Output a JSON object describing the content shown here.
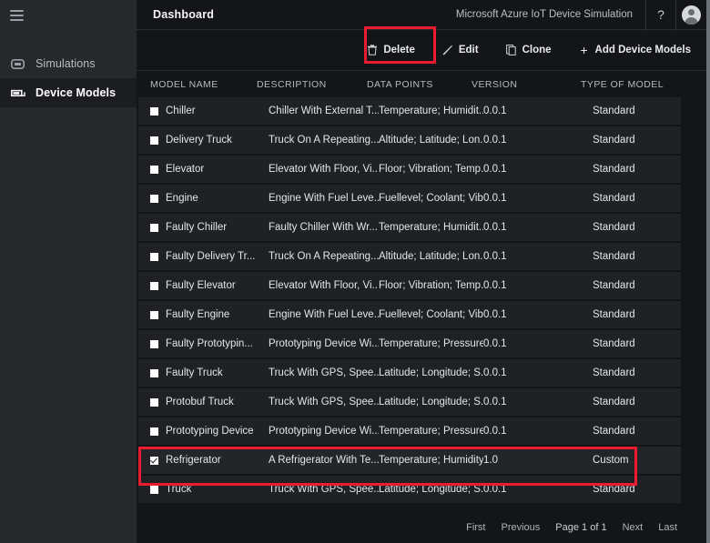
{
  "sidebar": {
    "menu_icon": "hamburger-icon",
    "items": [
      {
        "label": "Simulations",
        "icon": "simulations-icon",
        "active": false
      },
      {
        "label": "Device Models",
        "icon": "device-models-icon",
        "active": true
      }
    ]
  },
  "topbar": {
    "title": "Dashboard",
    "app_name": "Microsoft Azure IoT Device Simulation",
    "help_label": "?",
    "avatar": "user-avatar-icon"
  },
  "toolbar": {
    "delete_label": "Delete",
    "edit_label": "Edit",
    "clone_label": "Clone",
    "add_label": "Add Device Models",
    "delete_icon": "trash-icon",
    "edit_icon": "pencil-icon",
    "clone_icon": "copy-icon",
    "add_icon": "plus-icon"
  },
  "table": {
    "headers": {
      "name": "MODEL NAME",
      "description": "DESCRIPTION",
      "datapoints": "DATA POINTS",
      "version": "VERSION",
      "type": "TYPE OF MODEL"
    },
    "rows": [
      {
        "name": "Chiller",
        "description": "Chiller With External T...",
        "datapoints": "Temperature; Humidit...",
        "version": "0.0.1",
        "type": "Standard",
        "selected": false
      },
      {
        "name": "Delivery Truck",
        "description": "Truck On A Repeating...",
        "datapoints": "Altitude; Latitude; Lon...",
        "version": "0.0.1",
        "type": "Standard",
        "selected": false
      },
      {
        "name": "Elevator",
        "description": "Elevator With Floor, Vi...",
        "datapoints": "Floor; Vibration; Temp...",
        "version": "0.0.1",
        "type": "Standard",
        "selected": false
      },
      {
        "name": "Engine",
        "description": "Engine With Fuel Leve...",
        "datapoints": "Fuellevel; Coolant; Vib...",
        "version": "0.0.1",
        "type": "Standard",
        "selected": false
      },
      {
        "name": "Faulty Chiller",
        "description": "Faulty Chiller With Wr...",
        "datapoints": "Temperature; Humidit...",
        "version": "0.0.1",
        "type": "Standard",
        "selected": false
      },
      {
        "name": "Faulty Delivery Tr...",
        "description": "Truck On A Repeating...",
        "datapoints": "Altitude; Latitude; Lon...",
        "version": "0.0.1",
        "type": "Standard",
        "selected": false
      },
      {
        "name": "Faulty Elevator",
        "description": "Elevator With Floor, Vi...",
        "datapoints": "Floor; Vibration; Temp...",
        "version": "0.0.1",
        "type": "Standard",
        "selected": false
      },
      {
        "name": "Faulty Engine",
        "description": "Engine With Fuel Leve...",
        "datapoints": "Fuellevel; Coolant; Vib...",
        "version": "0.0.1",
        "type": "Standard",
        "selected": false
      },
      {
        "name": "Faulty Prototypin...",
        "description": "Prototyping Device Wi...",
        "datapoints": "Temperature; Pressure...",
        "version": "0.0.1",
        "type": "Standard",
        "selected": false
      },
      {
        "name": "Faulty Truck",
        "description": "Truck With GPS, Spee...",
        "datapoints": "Latitude; Longitude; S...",
        "version": "0.0.1",
        "type": "Standard",
        "selected": false
      },
      {
        "name": "Protobuf Truck",
        "description": "Truck With GPS, Spee...",
        "datapoints": "Latitude; Longitude; S...",
        "version": "0.0.1",
        "type": "Standard",
        "selected": false
      },
      {
        "name": "Prototyping Device",
        "description": "Prototyping Device Wi...",
        "datapoints": "Temperature; Pressure...",
        "version": "0.0.1",
        "type": "Standard",
        "selected": false
      },
      {
        "name": "Refrigerator",
        "description": "A Refrigerator With Te...",
        "datapoints": "Temperature; Humidity",
        "version": "1.0",
        "type": "Custom",
        "selected": true
      },
      {
        "name": "Truck",
        "description": "Truck With GPS, Spee...",
        "datapoints": "Latitude; Longitude; S...",
        "version": "0.0.1",
        "type": "Standard",
        "selected": false
      }
    ]
  },
  "pagination": {
    "first": "First",
    "previous": "Previous",
    "page_text": "Page 1 of 1",
    "next": "Next",
    "last": "Last"
  },
  "highlights": {
    "color": "#ec1c30",
    "targets": [
      "delete-button",
      "refrigerator-row"
    ]
  }
}
